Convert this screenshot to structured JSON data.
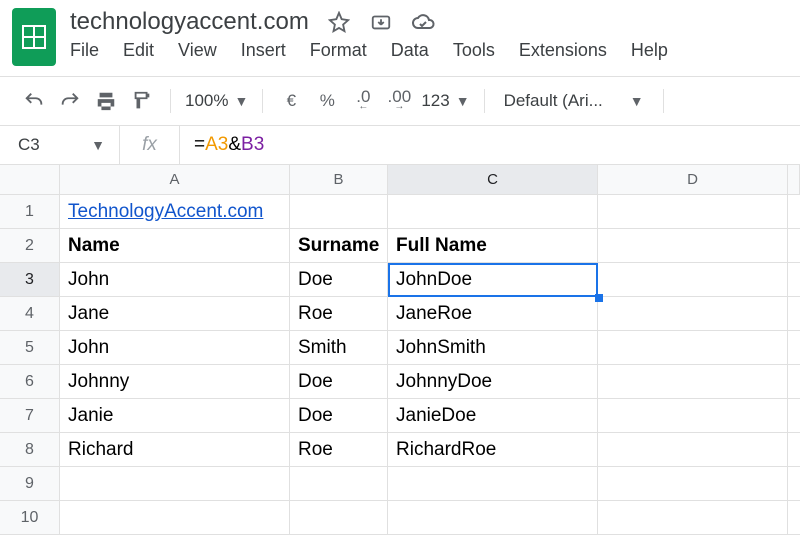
{
  "doc": {
    "title": "technologyaccent.com"
  },
  "menu": {
    "file": "File",
    "edit": "Edit",
    "view": "View",
    "insert": "Insert",
    "format": "Format",
    "data": "Data",
    "tools": "Tools",
    "extensions": "Extensions",
    "help": "Help"
  },
  "toolbar": {
    "zoom": "100%",
    "currency": "€",
    "percent": "%",
    "dec_dec": ".0",
    "dec_inc": ".00",
    "numfmt": "123",
    "font": "Default (Ari...",
    "dec_dec_sub": "←",
    "dec_inc_sub": "→"
  },
  "formula": {
    "name_box": "C3",
    "fx": "fx",
    "eq": "=",
    "a3": "A3",
    "amp": "&",
    "b3": "B3"
  },
  "columns": [
    "A",
    "B",
    "C",
    "D",
    ""
  ],
  "row_numbers": [
    "1",
    "2",
    "3",
    "4",
    "5",
    "6",
    "7",
    "8",
    "9",
    "10"
  ],
  "selection": {
    "col": "C",
    "row": 3
  },
  "chart_data": {
    "type": "table",
    "title": "",
    "headers": [
      "Name",
      "Surname",
      "Full Name"
    ],
    "link_cell": "TechnologyAccent.com",
    "rows": [
      {
        "name": "John",
        "surname": "Doe",
        "full": "JohnDoe"
      },
      {
        "name": "Jane",
        "surname": "Roe",
        "full": "JaneRoe"
      },
      {
        "name": "John",
        "surname": "Smith",
        "full": "JohnSmith"
      },
      {
        "name": "Johnny",
        "surname": "Doe",
        "full": "JohnnyDoe"
      },
      {
        "name": "Janie",
        "surname": "Doe",
        "full": "JanieDoe"
      },
      {
        "name": "Richard",
        "surname": "Roe",
        "full": "RichardRoe"
      }
    ]
  }
}
